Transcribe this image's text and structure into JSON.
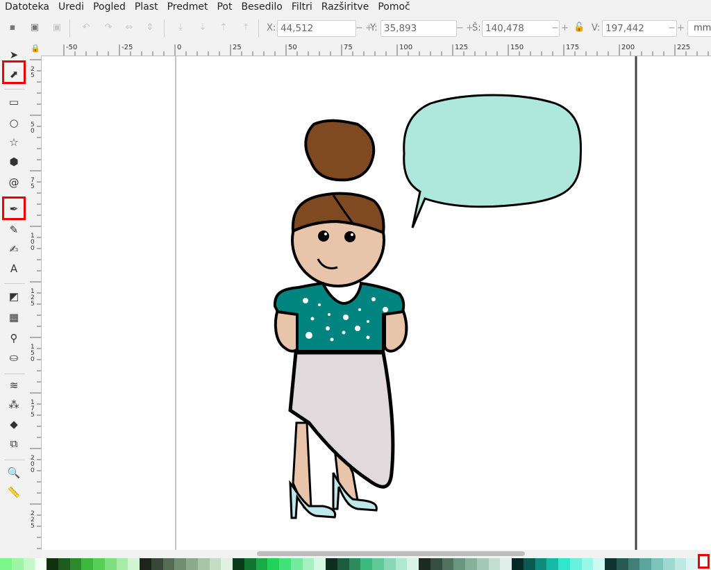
{
  "menu": [
    "Datoteka",
    "Uredi",
    "Pogled",
    "Plast",
    "Predmet",
    "Pot",
    "Besedilo",
    "Filtri",
    "Razširitve",
    "Pomoč"
  ],
  "toolbar": {
    "x_label": "X:",
    "x_value": "44,512",
    "y_label": "Y:",
    "y_value": "35,893",
    "w_label": "Š:",
    "w_value": "140,478",
    "h_label": "V:",
    "h_value": "197,442",
    "unit": "mm",
    "minus": "−",
    "plus": "+"
  },
  "ruler": {
    "h_labels": [
      "-50",
      "-25",
      "0",
      "25",
      "50",
      "75",
      "100",
      "125",
      "150",
      "175",
      "200",
      "225"
    ],
    "v_labels": [
      "2\n5",
      "5\n0",
      "7\n5",
      "1\n0\n0",
      "1\n2\n5",
      "1\n5\n0",
      "1\n7\n5",
      "2\n0\n0",
      "2\n2\n5"
    ]
  },
  "tools": [
    {
      "name": "selector-tool",
      "glyph": "➤"
    },
    {
      "name": "node-tool",
      "glyph": "⬈"
    },
    {
      "name": "rectangle-tool",
      "glyph": "▭"
    },
    {
      "name": "circle-tool",
      "glyph": "○"
    },
    {
      "name": "star-tool",
      "glyph": "☆"
    },
    {
      "name": "3d-box-tool",
      "glyph": "⬢"
    },
    {
      "name": "spiral-tool",
      "glyph": "@"
    },
    {
      "name": "bezier-pen-tool",
      "glyph": "✒"
    },
    {
      "name": "pencil-tool",
      "glyph": "✎"
    },
    {
      "name": "calligraphy-tool",
      "glyph": "✍"
    },
    {
      "name": "text-tool",
      "glyph": "A"
    },
    {
      "name": "gradient-tool",
      "glyph": "◩"
    },
    {
      "name": "mesh-tool",
      "glyph": "▦"
    },
    {
      "name": "dropper-tool",
      "glyph": "⚲"
    },
    {
      "name": "paint-bucket-tool",
      "glyph": "⛀"
    },
    {
      "name": "tweak-tool",
      "glyph": "≋"
    },
    {
      "name": "spray-tool",
      "glyph": "⁂"
    },
    {
      "name": "eraser-tool",
      "glyph": "◆"
    },
    {
      "name": "connector-tool",
      "glyph": "⧉"
    },
    {
      "name": "zoom-tool",
      "glyph": "🔍"
    },
    {
      "name": "measure-tool",
      "glyph": "📏"
    }
  ],
  "colors": {
    "bubble_fill": "#aee8dc",
    "hair": "#7f4a22",
    "skin": "#e8c4aa",
    "shirt": "#00847f",
    "skirt": "#e0dadc",
    "shoes": "#bfe8ea",
    "highlight": "#ee0000"
  },
  "palette": [
    "#7cf78c",
    "#9ef5a6",
    "#c3f8c8",
    "#f4fff4",
    "#103010",
    "#1f5a1f",
    "#2e8a2e",
    "#3cb83c",
    "#58d058",
    "#7fe07f",
    "#a7eba7",
    "#d2f5d2",
    "#1c241c",
    "#384838",
    "#546c54",
    "#708f70",
    "#8cab8c",
    "#a8c5a8",
    "#c4dec4",
    "#e1f0e1",
    "#0a3b1a",
    "#127530",
    "#1aab46",
    "#22d35a",
    "#42e27a",
    "#73ea9c",
    "#a4f1bf",
    "#d4f8e1",
    "#0d2e1f",
    "#1d5c3e",
    "#2d8b5d",
    "#3cb97c",
    "#60c999",
    "#88d8b5",
    "#b0e7d1",
    "#d8f3e8",
    "#1b2b24",
    "#354f42",
    "#4f735f",
    "#69977d",
    "#86b09a",
    "#a4c8b7",
    "#c2ded3",
    "#e0efe9",
    "#052a26",
    "#0b5a51",
    "#108a7c",
    "#16b9a6",
    "#32e6cd",
    "#66f2df",
    "#99f7ea",
    "#ccfbf4",
    "#0f3430",
    "#2a5a54",
    "#427f78",
    "#5ba59c",
    "#7cc3ba",
    "#9dd9d1",
    "#bde9e3",
    "#def4f1"
  ]
}
